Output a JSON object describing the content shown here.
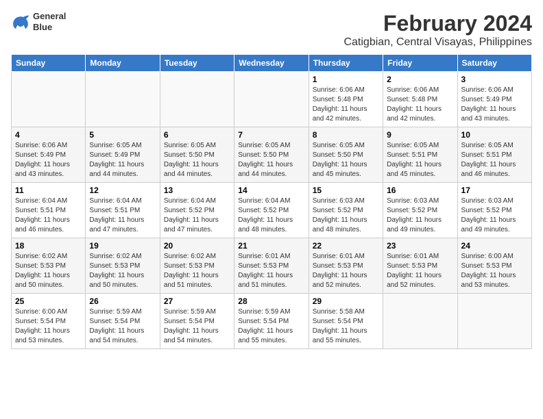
{
  "header": {
    "logo_line1": "General",
    "logo_line2": "Blue",
    "title": "February 2024",
    "subtitle": "Catigbian, Central Visayas, Philippines"
  },
  "weekdays": [
    "Sunday",
    "Monday",
    "Tuesday",
    "Wednesday",
    "Thursday",
    "Friday",
    "Saturday"
  ],
  "weeks": [
    [
      {
        "day": "",
        "text": ""
      },
      {
        "day": "",
        "text": ""
      },
      {
        "day": "",
        "text": ""
      },
      {
        "day": "",
        "text": ""
      },
      {
        "day": "1",
        "text": "Sunrise: 6:06 AM\nSunset: 5:48 PM\nDaylight: 11 hours and 42 minutes."
      },
      {
        "day": "2",
        "text": "Sunrise: 6:06 AM\nSunset: 5:48 PM\nDaylight: 11 hours and 42 minutes."
      },
      {
        "day": "3",
        "text": "Sunrise: 6:06 AM\nSunset: 5:49 PM\nDaylight: 11 hours and 43 minutes."
      }
    ],
    [
      {
        "day": "4",
        "text": "Sunrise: 6:06 AM\nSunset: 5:49 PM\nDaylight: 11 hours and 43 minutes."
      },
      {
        "day": "5",
        "text": "Sunrise: 6:05 AM\nSunset: 5:49 PM\nDaylight: 11 hours and 44 minutes."
      },
      {
        "day": "6",
        "text": "Sunrise: 6:05 AM\nSunset: 5:50 PM\nDaylight: 11 hours and 44 minutes."
      },
      {
        "day": "7",
        "text": "Sunrise: 6:05 AM\nSunset: 5:50 PM\nDaylight: 11 hours and 44 minutes."
      },
      {
        "day": "8",
        "text": "Sunrise: 6:05 AM\nSunset: 5:50 PM\nDaylight: 11 hours and 45 minutes."
      },
      {
        "day": "9",
        "text": "Sunrise: 6:05 AM\nSunset: 5:51 PM\nDaylight: 11 hours and 45 minutes."
      },
      {
        "day": "10",
        "text": "Sunrise: 6:05 AM\nSunset: 5:51 PM\nDaylight: 11 hours and 46 minutes."
      }
    ],
    [
      {
        "day": "11",
        "text": "Sunrise: 6:04 AM\nSunset: 5:51 PM\nDaylight: 11 hours and 46 minutes."
      },
      {
        "day": "12",
        "text": "Sunrise: 6:04 AM\nSunset: 5:51 PM\nDaylight: 11 hours and 47 minutes."
      },
      {
        "day": "13",
        "text": "Sunrise: 6:04 AM\nSunset: 5:52 PM\nDaylight: 11 hours and 47 minutes."
      },
      {
        "day": "14",
        "text": "Sunrise: 6:04 AM\nSunset: 5:52 PM\nDaylight: 11 hours and 48 minutes."
      },
      {
        "day": "15",
        "text": "Sunrise: 6:03 AM\nSunset: 5:52 PM\nDaylight: 11 hours and 48 minutes."
      },
      {
        "day": "16",
        "text": "Sunrise: 6:03 AM\nSunset: 5:52 PM\nDaylight: 11 hours and 49 minutes."
      },
      {
        "day": "17",
        "text": "Sunrise: 6:03 AM\nSunset: 5:52 PM\nDaylight: 11 hours and 49 minutes."
      }
    ],
    [
      {
        "day": "18",
        "text": "Sunrise: 6:02 AM\nSunset: 5:53 PM\nDaylight: 11 hours and 50 minutes."
      },
      {
        "day": "19",
        "text": "Sunrise: 6:02 AM\nSunset: 5:53 PM\nDaylight: 11 hours and 50 minutes."
      },
      {
        "day": "20",
        "text": "Sunrise: 6:02 AM\nSunset: 5:53 PM\nDaylight: 11 hours and 51 minutes."
      },
      {
        "day": "21",
        "text": "Sunrise: 6:01 AM\nSunset: 5:53 PM\nDaylight: 11 hours and 51 minutes."
      },
      {
        "day": "22",
        "text": "Sunrise: 6:01 AM\nSunset: 5:53 PM\nDaylight: 11 hours and 52 minutes."
      },
      {
        "day": "23",
        "text": "Sunrise: 6:01 AM\nSunset: 5:53 PM\nDaylight: 11 hours and 52 minutes."
      },
      {
        "day": "24",
        "text": "Sunrise: 6:00 AM\nSunset: 5:53 PM\nDaylight: 11 hours and 53 minutes."
      }
    ],
    [
      {
        "day": "25",
        "text": "Sunrise: 6:00 AM\nSunset: 5:54 PM\nDaylight: 11 hours and 53 minutes."
      },
      {
        "day": "26",
        "text": "Sunrise: 5:59 AM\nSunset: 5:54 PM\nDaylight: 11 hours and 54 minutes."
      },
      {
        "day": "27",
        "text": "Sunrise: 5:59 AM\nSunset: 5:54 PM\nDaylight: 11 hours and 54 minutes."
      },
      {
        "day": "28",
        "text": "Sunrise: 5:59 AM\nSunset: 5:54 PM\nDaylight: 11 hours and 55 minutes."
      },
      {
        "day": "29",
        "text": "Sunrise: 5:58 AM\nSunset: 5:54 PM\nDaylight: 11 hours and 55 minutes."
      },
      {
        "day": "",
        "text": ""
      },
      {
        "day": "",
        "text": ""
      }
    ]
  ]
}
